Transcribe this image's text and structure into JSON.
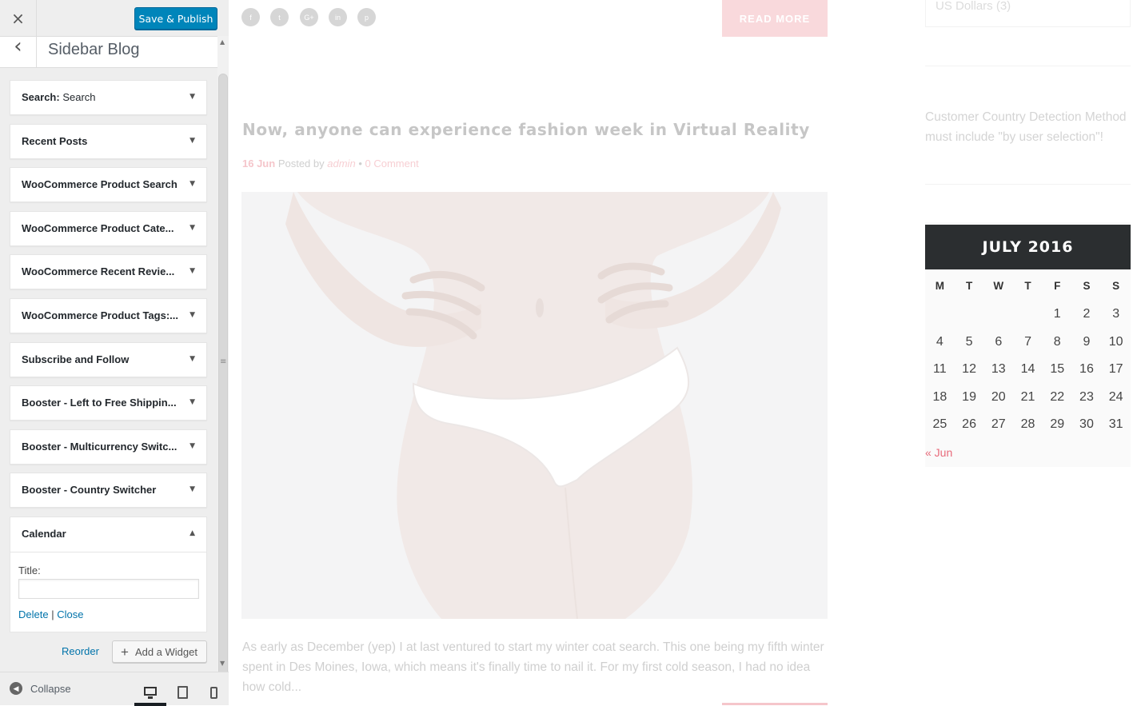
{
  "customizer": {
    "close_icon": "×",
    "publish_label": "Save & Publish",
    "back_icon": "‹",
    "section_title": "Sidebar Blog",
    "widgets": [
      {
        "title": "Search:",
        "subtitle": " Search"
      },
      {
        "title": "Recent Posts",
        "subtitle": ""
      },
      {
        "title": "WooCommerce Product Search",
        "subtitle": ""
      },
      {
        "title": "WooCommerce Product Cate...",
        "subtitle": ""
      },
      {
        "title": "WooCommerce Recent Revie...",
        "subtitle": ""
      },
      {
        "title": "WooCommerce Product Tags:...",
        "subtitle": ""
      },
      {
        "title": "Subscribe and Follow",
        "subtitle": ""
      },
      {
        "title": "Booster - Left to Free Shippin...",
        "subtitle": ""
      },
      {
        "title": "Booster - Multicurrency Switc...",
        "subtitle": ""
      },
      {
        "title": "Booster - Country Switcher",
        "subtitle": ""
      }
    ],
    "calendar_widget": {
      "title": "Calendar",
      "field_label": "Title:",
      "field_value": "",
      "delete_label": "Delete",
      "separator": "|",
      "close_label": "Close"
    },
    "reorder_label": "Reorder",
    "add_widget_label": "Add a Widget",
    "collapse_label": "Collapse",
    "devices": [
      "desktop",
      "tablet",
      "mobile"
    ],
    "active_device": "desktop"
  },
  "preview": {
    "social_icons": [
      {
        "name": "facebook-icon",
        "glyph": "f"
      },
      {
        "name": "twitter-icon",
        "glyph": "t"
      },
      {
        "name": "google-plus-icon",
        "glyph": "G+"
      },
      {
        "name": "linkedin-icon",
        "glyph": "in"
      },
      {
        "name": "pinterest-icon",
        "glyph": "p"
      }
    ],
    "read_more_label": "READ MORE",
    "post_title": "Now, anyone can experience fashion week in Virtual Reality",
    "post_date": "16 Jun",
    "posted_by": "Posted by",
    "author": "admin",
    "bullet": "•",
    "comments": "0 Comment",
    "excerpt": "As early as December (yep) I at last ventured to start my winter coat search. This one being my fifth winter spent in Des Moines, Iowa, which means it's finally time to nail it. For my first cold season, I had no idea how cold...",
    "currency_box_text": "US Dollars (3)",
    "country_note": "Customer Country Detection Method must include \"by user selection\"!",
    "calendar": {
      "month_title": "JULY 2016",
      "days_of_week": [
        "M",
        "T",
        "W",
        "T",
        "F",
        "S",
        "S"
      ],
      "weeks": [
        [
          "",
          "",
          "",
          "",
          "1",
          "2",
          "3"
        ],
        [
          "4",
          "5",
          "6",
          "7",
          "8",
          "9",
          "10"
        ],
        [
          "11",
          "12",
          "13",
          "14",
          "15",
          "16",
          "17"
        ],
        [
          "18",
          "19",
          "20",
          "21",
          "22",
          "23",
          "24"
        ],
        [
          "25",
          "26",
          "27",
          "28",
          "29",
          "30",
          "31"
        ]
      ],
      "prev_link": "« Jun"
    }
  },
  "colors": {
    "accent_blue": "#0085ba",
    "link_blue": "#0073aa",
    "pink": "#e86a7a",
    "calendar_header": "#2b2e30"
  }
}
